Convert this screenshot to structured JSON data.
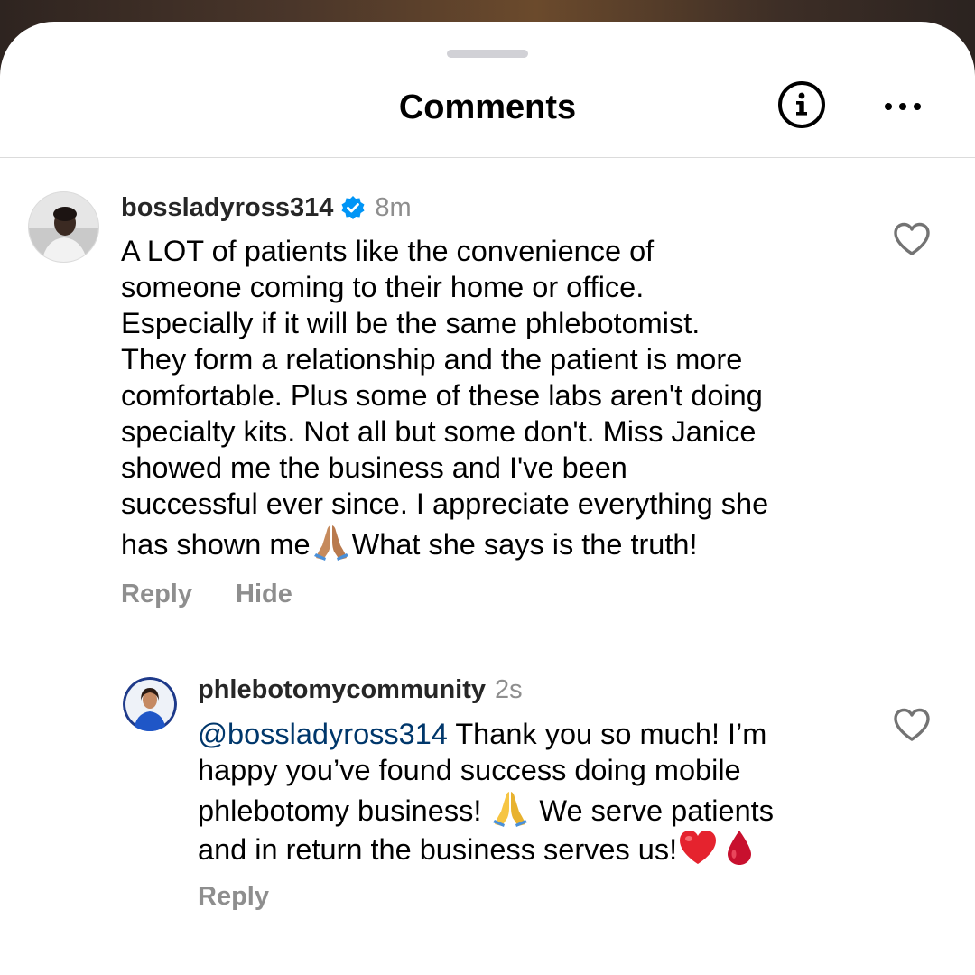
{
  "header": {
    "title": "Comments",
    "info_icon": "info-circle-icon",
    "more_icon": "more-horizontal-icon"
  },
  "comments": [
    {
      "username": "bossladyross314",
      "verified": true,
      "time": "8m",
      "lines": [
        "A LOT of patients like the convenience of",
        "someone coming to their home or office.",
        "Especially if it will be the same phlebotomist.",
        "They form a relationship and the patient is more",
        "comfortable. Plus some of these labs aren't doing",
        "specialty kits. Not all but some don't. Miss Janice",
        "showed me the business and I've been",
        "successful ever since. I appreciate everything she"
      ],
      "last_line_before": "has shown me",
      "last_line_emoji": "🙏🏽",
      "last_line_after": "What she says is the truth!",
      "reply_label": "Reply",
      "hide_label": "Hide"
    },
    {
      "username": "phlebotomycommunity",
      "time": "2s",
      "mention": "@bossladyross314",
      "line1_after_mention": " Thank you so much! I’m",
      "line2": "happy you’ve found success doing mobile",
      "line3_before": "phlebotomy business! ",
      "line3_emoji": "🙏",
      "line3_after": " We serve patients",
      "line4": "and in return the business serves us!",
      "line4_emoji_heart": "❤️",
      "line4_emoji_drop": "🩸",
      "reply_label": "Reply"
    }
  ],
  "colors": {
    "username": "#262626",
    "meta": "#8e8e8e",
    "mention": "#00376b",
    "verified": "#0095f6"
  }
}
